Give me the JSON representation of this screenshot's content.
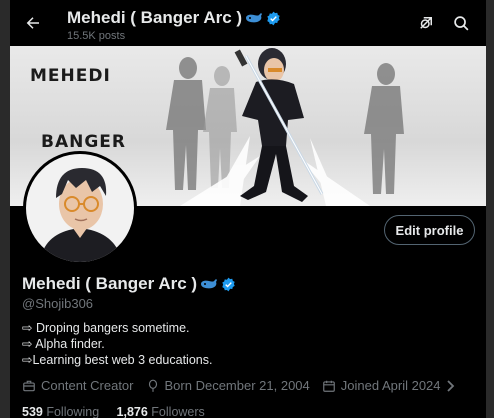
{
  "header": {
    "title": "Mehedi ( Banger Arc )",
    "posts": "15.5K posts"
  },
  "banner": {
    "text_top": "MEHEDI",
    "text_bottom": "BANGER"
  },
  "profile": {
    "edit_label": "Edit profile",
    "name": "Mehedi ( Banger Arc )",
    "handle": "@Shojib306",
    "bio": [
      "⇨ Droping bangers sometime.",
      "⇨ Alpha finder.",
      "⇨Learning best web 3 educations."
    ],
    "category": "Content Creator",
    "born": "Born December 21, 2004",
    "joined": "Joined April 2024",
    "following_count": "539",
    "following_label": "Following",
    "followers_count": "1,876",
    "followers_label": "Followers"
  },
  "colors": {
    "verified": "#1d9bf0",
    "muted": "#71767b",
    "text": "#e7e9ea",
    "background": "#000000",
    "whale": "#3d8fd6"
  },
  "icons": [
    "back-arrow-icon",
    "grok-icon",
    "search-icon",
    "verified-badge-icon",
    "whale-icon",
    "briefcase-icon",
    "balloon-icon",
    "calendar-icon",
    "chevron-right-icon"
  ]
}
